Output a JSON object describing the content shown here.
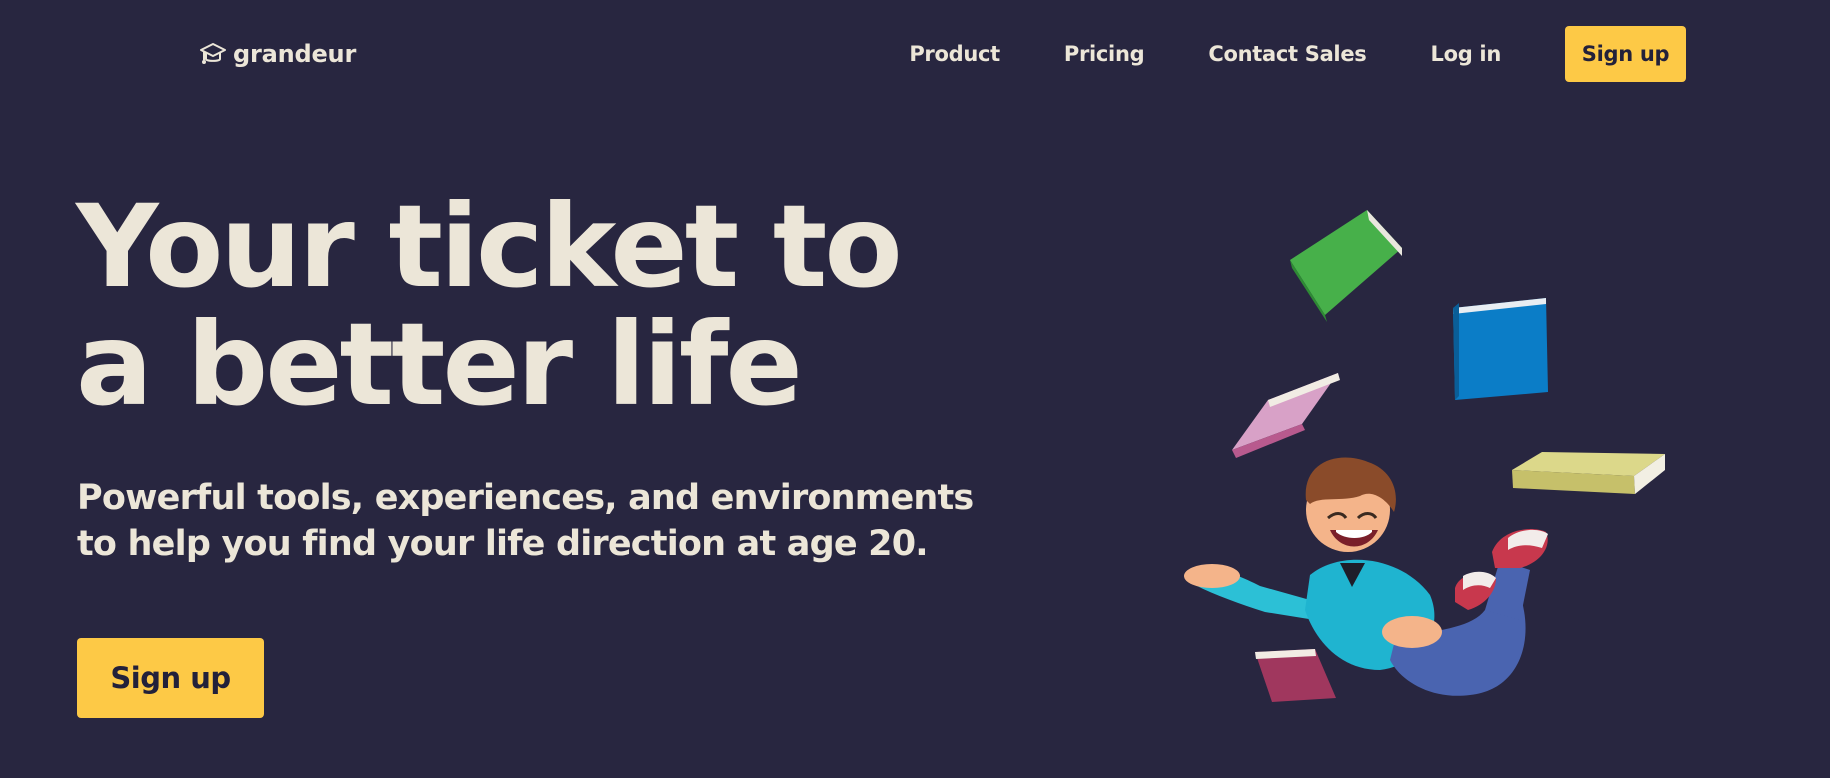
{
  "brand": {
    "name": "grandeur",
    "icon": "graduation-cap-icon"
  },
  "nav": {
    "links": [
      "Product",
      "Pricing",
      "Contact Sales",
      "Log in"
    ],
    "signup_label": "Sign up"
  },
  "hero": {
    "title_line1": "Your ticket to",
    "title_line2": "a better life",
    "subtitle_line1": "Powerful tools, experiences, and environments",
    "subtitle_line2": "to help you find your life direction at age 20.",
    "cta_label": "Sign up",
    "illustration": "boy-juggling-books-illustration"
  },
  "colors": {
    "background": "#282640",
    "text": "#ece6d8",
    "accent": "#fdc946",
    "button_text": "#23213a"
  }
}
